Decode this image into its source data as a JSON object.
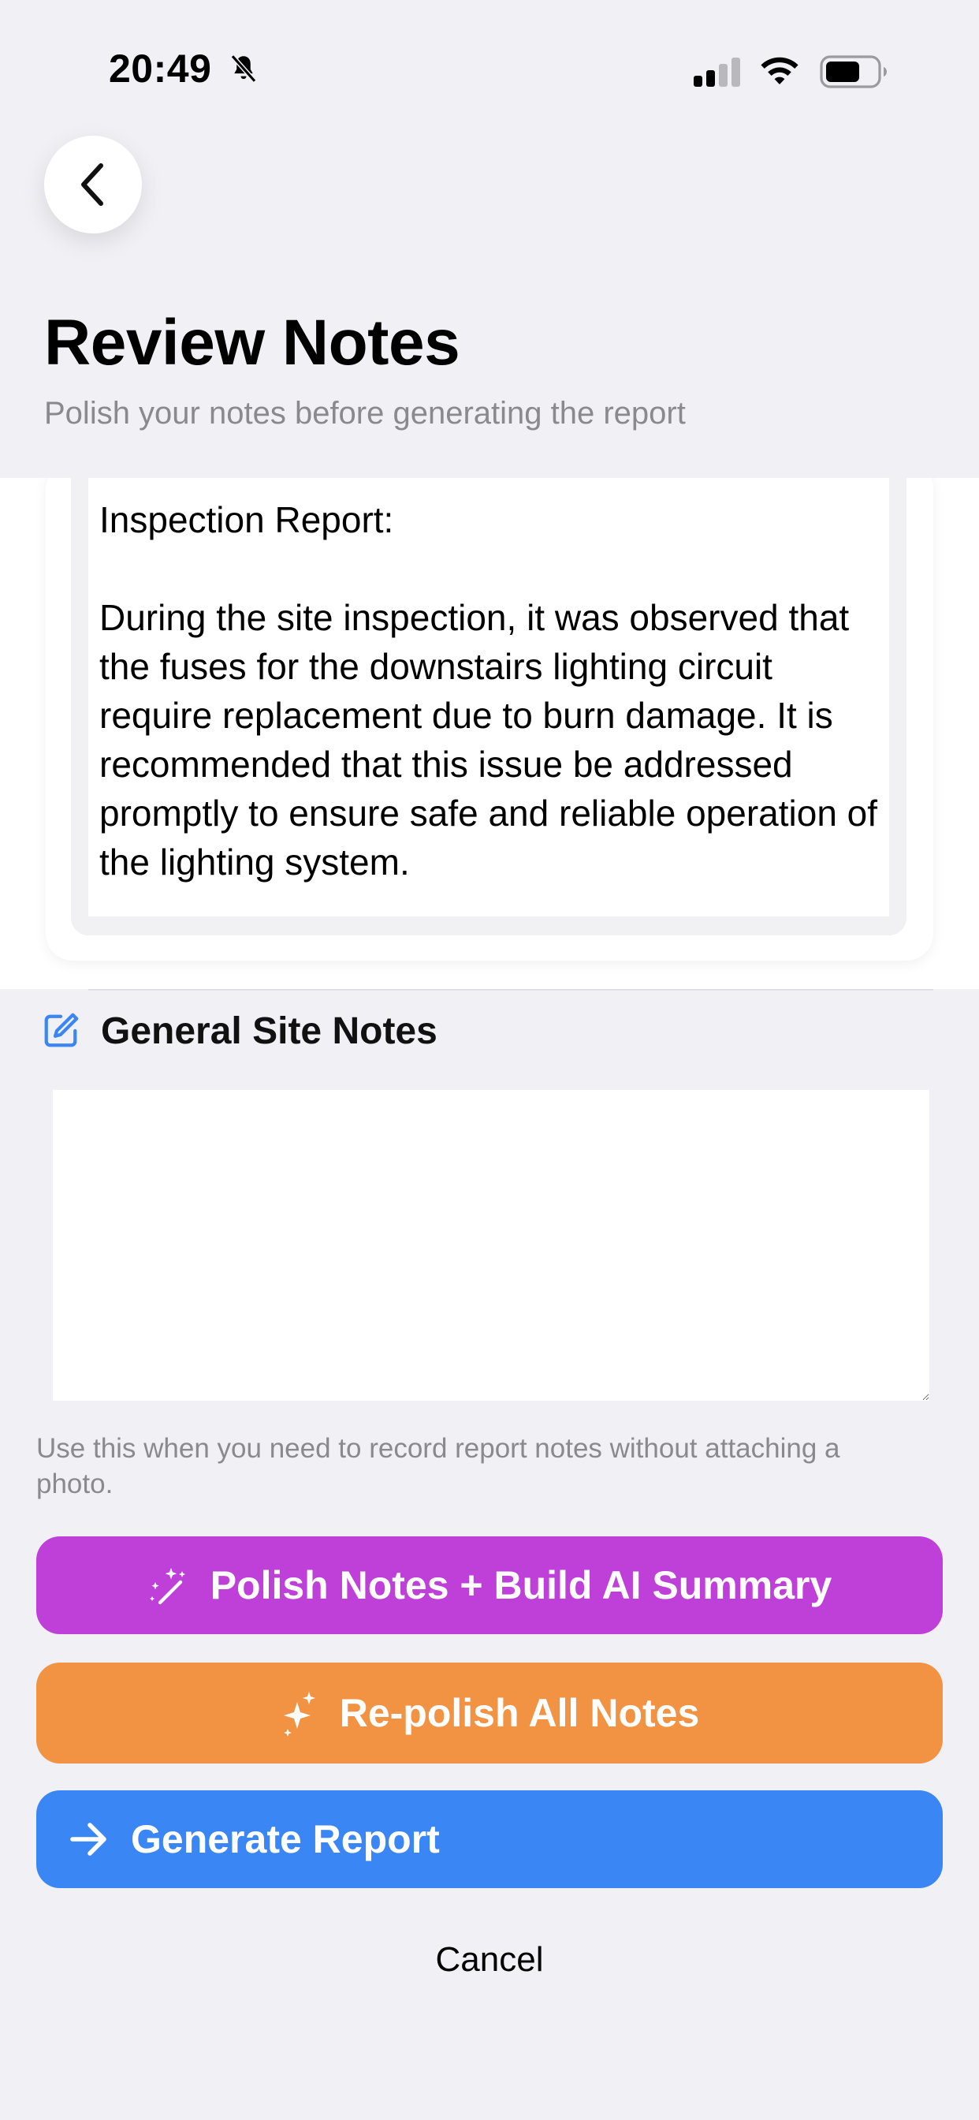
{
  "status_bar": {
    "time": "20:49",
    "icons": [
      "bell-slash-icon",
      "cellular-signal-icon",
      "wifi-icon",
      "battery-icon"
    ]
  },
  "header": {
    "back_icon": "chevron-left-icon",
    "title": "Review Notes",
    "subtitle": "Polish your notes before generating the report"
  },
  "note_card": {
    "text": "Inspection Report:\n\nDuring the site inspection, it was observed that the fuses for the downstairs lighting circuit require replacement due to burn damage. It is recommended that this issue be addressed promptly to ensure safe and reliable operation of the lighting system."
  },
  "general_notes": {
    "icon": "square-pencil-icon",
    "label": "General Site Notes",
    "value": "",
    "helper": "Use this when you need to record report notes without attaching a photo."
  },
  "actions": {
    "polish": {
      "label": "Polish Notes + Build AI Summary",
      "icon": "magic-wand-icon",
      "color": "#bf3fd9"
    },
    "repolish": {
      "label": "Re-polish All Notes",
      "icon": "sparkles-icon",
      "color": "#f19342"
    },
    "generate": {
      "label": "Generate Report",
      "icon": "arrow-right-icon",
      "color": "#3a86f4"
    },
    "cancel": "Cancel"
  },
  "colors": {
    "background": "#f0f0f5",
    "secondary_text": "#8a8a8e",
    "accent_blue": "#3a86f4"
  }
}
